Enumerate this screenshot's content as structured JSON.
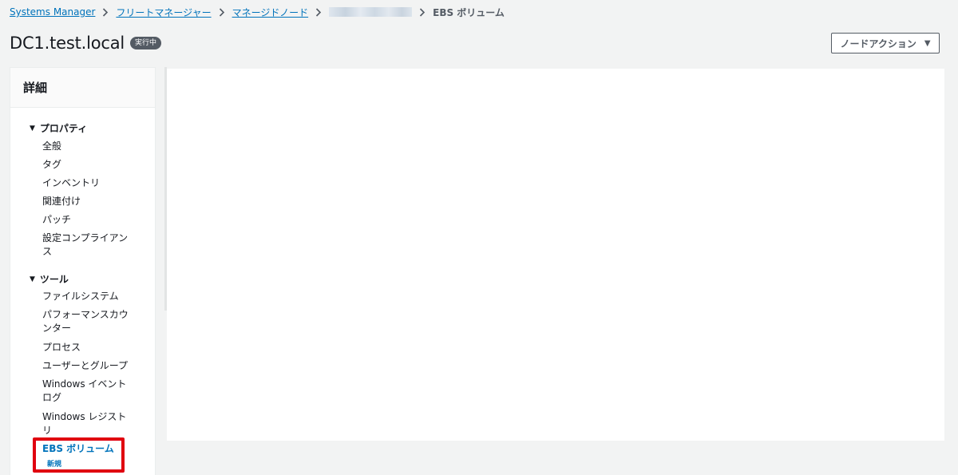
{
  "breadcrumb": {
    "items": [
      "Systems Manager",
      "フリートマネージャー",
      "マネージドノード"
    ],
    "current": "EBS ボリューム"
  },
  "header": {
    "title": "DC1.test.local",
    "status": "実行中",
    "action_button": "ノードアクション"
  },
  "sidebar": {
    "title": "詳細",
    "groups": [
      {
        "label": "プロパティ",
        "items": [
          "全般",
          "タグ",
          "インベントリ",
          "関連付け",
          "パッチ",
          "設定コンプライアンス"
        ]
      },
      {
        "label": "ツール",
        "items": [
          "ファイルシステム",
          "パフォーマンスカウンター",
          "プロセス",
          "ユーザーとグループ",
          "Windows イベントログ",
          "Windows レジストリ",
          "EBS ボリューム"
        ]
      }
    ],
    "active_item_badge": "新規"
  },
  "colors": {
    "link": "#0073bb",
    "highlight": "#e0000f",
    "badge_bg": "#545b64",
    "page_bg": "#f2f3f3"
  },
  "icons": {
    "separator": "chevron-right-icon",
    "expand": "triangle-down-icon",
    "dropdown": "caret-down-icon"
  }
}
